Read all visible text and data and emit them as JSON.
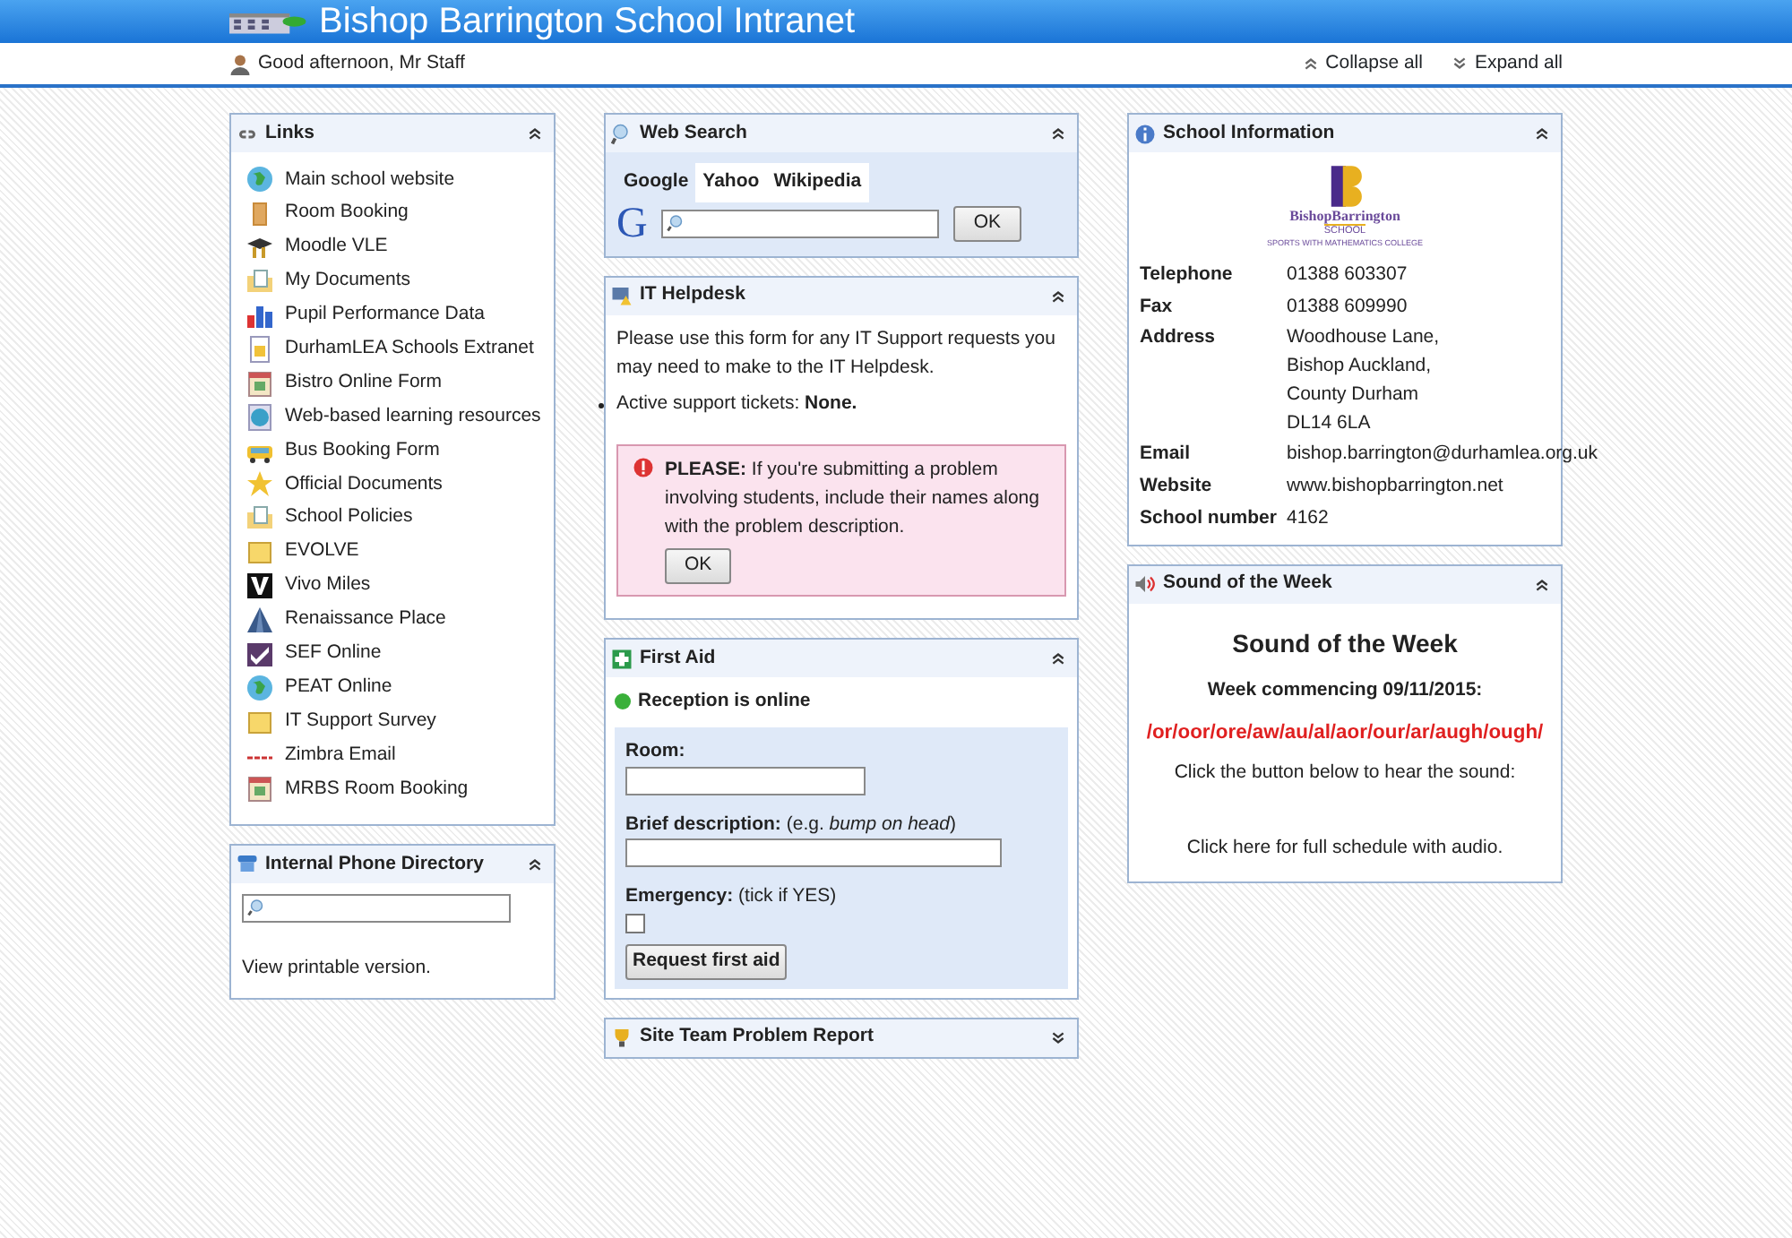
{
  "header": {
    "title": "Bishop Barrington School Intranet",
    "greeting": "Good afternoon, Mr Staff",
    "actions": [
      {
        "label": "Collapse all",
        "kind": "collapse"
      },
      {
        "label": "Expand all",
        "kind": "expand"
      }
    ]
  },
  "columns": [
    [
      {
        "kind": "links",
        "title": "Links",
        "expanded": true,
        "items": [
          "Main school website",
          "Room Booking",
          "Moodle VLE",
          "My Documents",
          "Pupil Performance Data",
          "DurhamLEA Schools Extranet",
          "Bistro Online Form",
          "Web-based learning resources",
          "Bus Booking Form",
          "Official Documents",
          "School Policies",
          "EVOLVE",
          "Vivo Miles",
          "Renaissance Place",
          "SEF Online",
          "PEAT Online",
          "IT Support Survey",
          "Zimbra Email",
          "MRBS Room Booking"
        ]
      },
      {
        "kind": "phone",
        "title": "Internal Phone Directory",
        "expanded": true,
        "link": "View printable version."
      }
    ],
    [
      {
        "kind": "search",
        "title": "Web Search",
        "expanded": true,
        "tabs": [
          {
            "label": "Google",
            "selected": true
          },
          {
            "label": "Yahoo",
            "selected": false
          },
          {
            "label": "Wikipedia",
            "selected": false
          }
        ],
        "logo_letter": "G",
        "button": "OK"
      },
      {
        "kind": "helpdesk",
        "title": "IT Helpdesk",
        "expanded": true,
        "intro": "Please use this form for any IT Support requests you may need to make to the IT Helpdesk.",
        "tickets": "Active support tickets: **None.**",
        "alert": "**PLEASE:** If you're submitting a problem involving students, include their names along with the problem description.",
        "alert_button": "OK"
      },
      {
        "kind": "firstaid",
        "title": "First Aid",
        "expanded": true,
        "status": {
          "text": "Reception is online",
          "online": true
        },
        "fields": [
          {
            "kind": "text",
            "label": "**Room:**",
            "wide": false
          },
          {
            "kind": "text",
            "label": "**Brief description:** (e.g. *bump on head*)",
            "wide": true
          },
          {
            "kind": "checkbox",
            "label": "**Emergency:** (tick if YES)",
            "checked": false
          }
        ],
        "button": "Request first aid"
      },
      {
        "kind": "collapsed",
        "title": "Site Team Problem Report",
        "expanded": false
      }
    ],
    [
      {
        "kind": "info",
        "title": "School Information",
        "expanded": true,
        "logo": {
          "name": "BishopBarrington",
          "school": "SCHOOL",
          "tagline": "SPORTS WITH MATHEMATICS COLLEGE"
        },
        "rows": [
          {
            "label": "Telephone",
            "lines": [
              "01388 603307"
            ]
          },
          {
            "label": "Fax",
            "lines": [
              "01388 609990"
            ]
          },
          {
            "label": "Address",
            "lines": [
              "Woodhouse Lane,",
              "Bishop Auckland,",
              "County Durham",
              "DL14 6LA"
            ]
          },
          {
            "label": "Email",
            "lines": [
              "bishop.barrington@durhamlea.org.uk"
            ]
          },
          {
            "label": "Website",
            "lines": [
              "www.bishopbarrington.net"
            ]
          },
          {
            "label": "School number",
            "lines": [
              "4162"
            ]
          }
        ]
      },
      {
        "kind": "sound",
        "title": "Sound of the Week",
        "expanded": true,
        "heading": "Sound of the Week",
        "week": "Week commencing 09/11/2015:",
        "sounds": "/or/oor/ore/aw/au/al/aor/our/ar/augh/ough/",
        "instruction": "Click the button below to hear the sound:",
        "link": "Click here for full schedule with audio."
      }
    ]
  ]
}
